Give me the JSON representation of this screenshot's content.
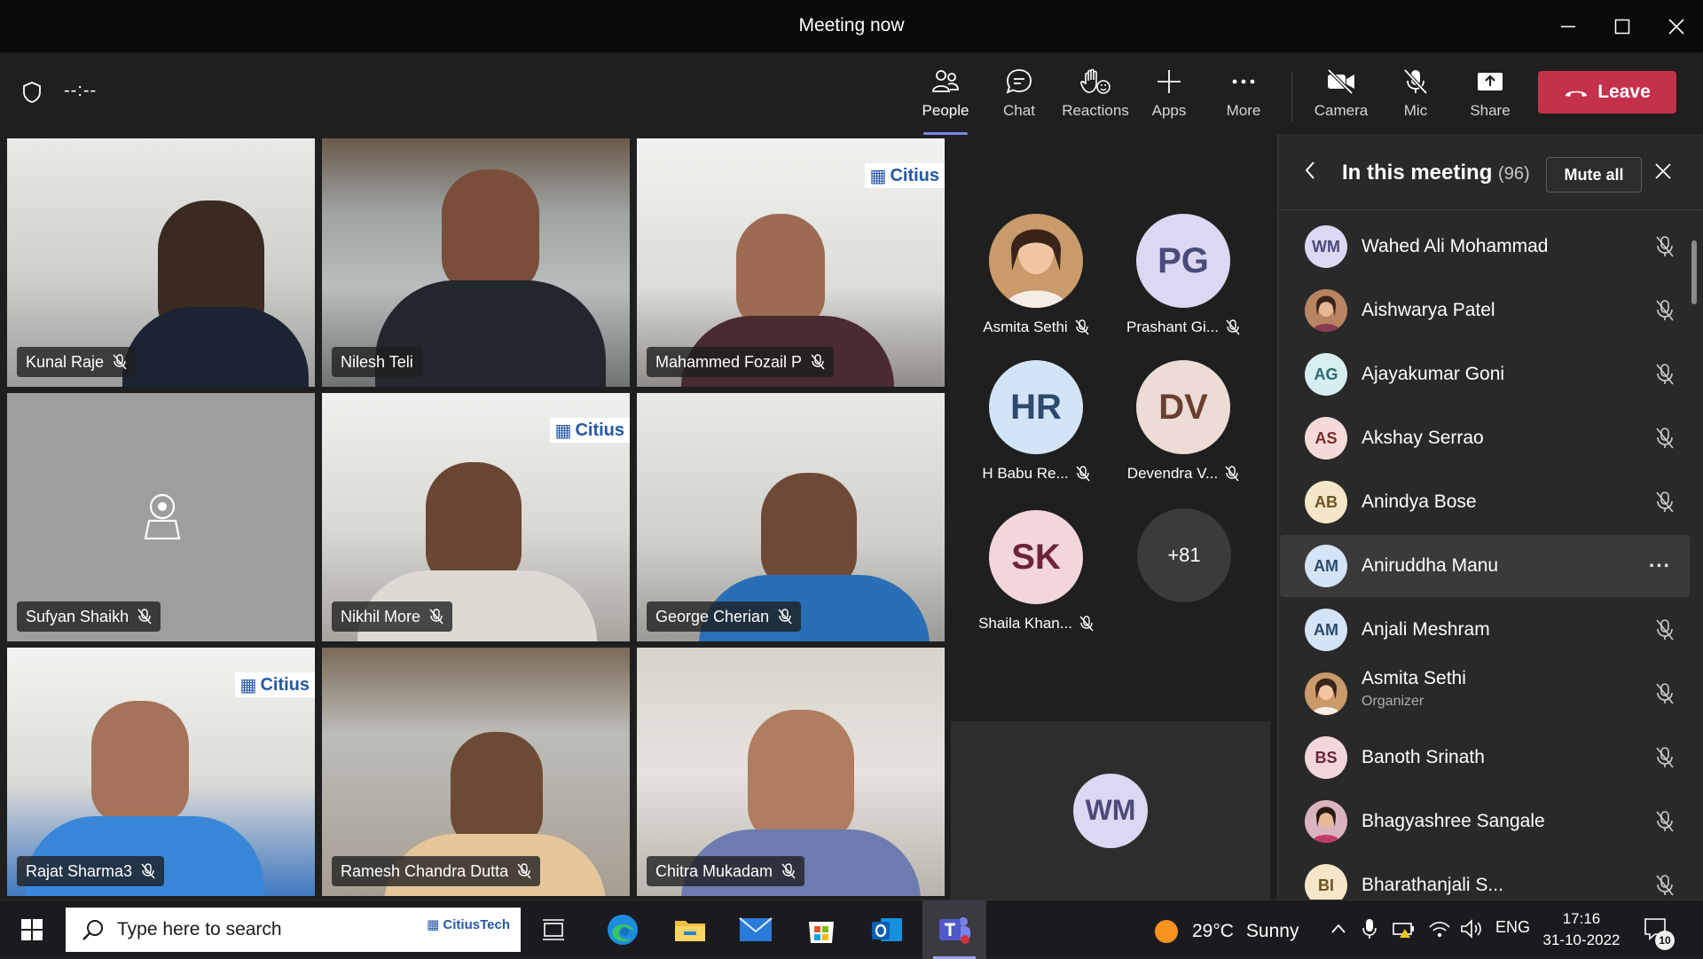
{
  "window": {
    "title": "Meeting now"
  },
  "toolbar": {
    "timer": "--:--",
    "buttons": [
      {
        "label": "People",
        "icon": "people-icon",
        "active": true
      },
      {
        "label": "Chat",
        "icon": "chat-icon"
      },
      {
        "label": "Reactions",
        "icon": "reactions-icon"
      },
      {
        "label": "Apps",
        "icon": "apps-plus-icon"
      },
      {
        "label": "More",
        "icon": "more-dots-icon"
      },
      {
        "label": "Camera",
        "icon": "camera-off-icon"
      },
      {
        "label": "Mic",
        "icon": "mic-off-icon"
      },
      {
        "label": "Share",
        "icon": "share-tray-icon"
      }
    ],
    "leave_label": "Leave"
  },
  "video_tiles": [
    {
      "name": "Kunal Raje",
      "muted": true,
      "scene": "office-dark"
    },
    {
      "name": "Nilesh Teli",
      "muted": false,
      "speaking": true,
      "scene": "room-window"
    },
    {
      "name": "Mahammed Fozail P",
      "muted": true,
      "scene": "office-bright",
      "brand": "Citius"
    },
    {
      "name": "Sufyan Shaikh",
      "muted": true,
      "scene": "camera-off"
    },
    {
      "name": "Nikhil More",
      "muted": true,
      "scene": "office-bright",
      "brand": "Citius"
    },
    {
      "name": "George Cherian",
      "muted": true,
      "scene": "room-white"
    },
    {
      "name": "Rajat Sharma3",
      "muted": true,
      "scene": "office-bright",
      "brand": "Citius"
    },
    {
      "name": "Ramesh Chandra Dutta",
      "muted": true,
      "scene": "room-window"
    },
    {
      "name": "Chitra Mukadam",
      "muted": true,
      "scene": "room-white"
    }
  ],
  "gallery": [
    {
      "name": "Asmita Sethi",
      "initials": "",
      "photo": true,
      "bg": "#a26b3e",
      "fg": "#ffffff"
    },
    {
      "name": "Prashant Gi...",
      "initials": "PG",
      "bg": "#dcd7f3",
      "fg": "#4b4a7a"
    },
    {
      "name": "H Babu Re...",
      "initials": "HR",
      "bg": "#d4e4f7",
      "fg": "#2c4a6e"
    },
    {
      "name": "Devendra V...",
      "initials": "DV",
      "bg": "#eddcd5",
      "fg": "#6b3e32"
    },
    {
      "name": "Shaila Khan...",
      "initials": "SK",
      "bg": "#f3d6dc",
      "fg": "#6d2437"
    }
  ],
  "gallery_overflow": "+81",
  "self_view": {
    "initials": "WM"
  },
  "panel": {
    "title": "In this meeting",
    "count": "(96)",
    "mute_all_label": "Mute all",
    "participants": [
      {
        "name": "Wahed Ali Mohammad",
        "initials": "WM",
        "bg": "#dcd7f3",
        "fg": "#4b4a7a"
      },
      {
        "name": "Aishwarya Patel",
        "initials": "",
        "photo": true,
        "bg": "#8b5a3c",
        "fg": "#ffffff"
      },
      {
        "name": "Ajayakumar Goni",
        "initials": "AG",
        "bg": "#d7eef0",
        "fg": "#2e6a70"
      },
      {
        "name": "Akshay Serrao",
        "initials": "AS",
        "bg": "#f6dada",
        "fg": "#7a2a2a"
      },
      {
        "name": "Anindya Bose",
        "initials": "AB",
        "bg": "#f5e6c8",
        "fg": "#6e5223"
      },
      {
        "name": "Aniruddha Manu",
        "initials": "AM",
        "bg": "#d4e4f7",
        "fg": "#2c4a6e",
        "highlighted": true
      },
      {
        "name": "Anjali Meshram",
        "initials": "AM",
        "bg": "#d4e4f7",
        "fg": "#2c4a6e"
      },
      {
        "name": "Asmita Sethi",
        "role": "Organizer",
        "initials": "",
        "photo": true,
        "bg": "#a26b3e",
        "fg": "#ffffff"
      },
      {
        "name": "Banoth Srinath",
        "initials": "BS",
        "bg": "#f3d6dc",
        "fg": "#6d2437"
      },
      {
        "name": "Bhagyashree Sangale",
        "initials": "",
        "photo": true,
        "bg": "#b07a8a",
        "fg": "#ffffff"
      },
      {
        "name": "Bharathanjali S...",
        "initials": "BI",
        "bg": "#f5e6c8",
        "fg": "#6e5223"
      }
    ]
  },
  "taskbar": {
    "search_placeholder": "Type here to search",
    "search_brand": "CitiusTech",
    "weather_temp": "29°C",
    "weather_desc": "Sunny",
    "language": "ENG",
    "time": "17:16",
    "date": "31-10-2022",
    "notifications": "10"
  },
  "colors": {
    "accent": "#7f85f5",
    "leave": "#c4314b",
    "panel": "#292929",
    "background": "#1f1f1f"
  }
}
